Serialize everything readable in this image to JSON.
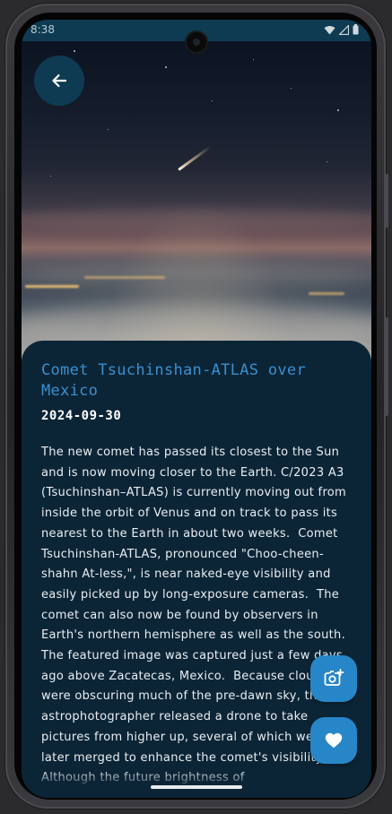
{
  "status_bar": {
    "time": "8:38",
    "icons": [
      "wifi-icon",
      "signal-icon",
      "battery-icon"
    ]
  },
  "header": {
    "back_icon": "arrow-left-icon"
  },
  "apod": {
    "title": "Comet Tsuchinshan-ATLAS over Mexico",
    "date": "2024-09-30",
    "description": "The new comet has passed its closest to the Sun and is now moving closer to the Earth. C/2023 A3 (Tsuchinshan–ATLAS) is currently moving out from inside the orbit of Venus and on track to pass its nearest to the Earth in about two weeks.  Comet Tsuchinshan-ATLAS, pronounced \"Choo-cheen-shahn At-less,\", is near naked-eye visibility and easily picked up by long-exposure cameras.  The comet can also now be found by observers in Earth's northern hemisphere as well as the south.  The featured image was captured just a few days ago above Zacatecas, Mexico.  Because clouds were obscuring much of the pre-dawn sky, the astrophotographer released a drone to take pictures from higher up, several of which were later merged to enhance the comet's visibility.  Although the future brightness of"
  },
  "actions": {
    "set_wallpaper_icon": "add-photo-icon",
    "favorite_icon": "heart-icon"
  },
  "colors": {
    "accent": "#2786c8",
    "title": "#3a8fd0",
    "card_bg": "#0c2536",
    "status_bar_bg": "#0e3b52"
  }
}
